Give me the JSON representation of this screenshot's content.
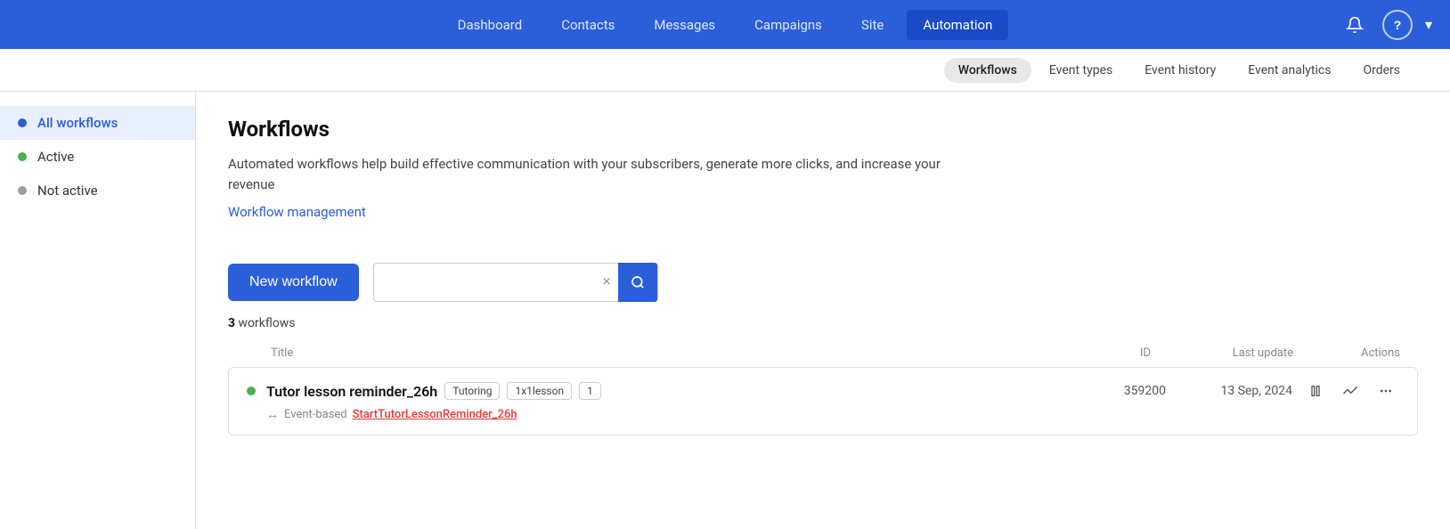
{
  "topnav": {
    "links": [
      {
        "label": "Dashboard",
        "active": false
      },
      {
        "label": "Contacts",
        "active": false
      },
      {
        "label": "Messages",
        "active": false
      },
      {
        "label": "Campaigns",
        "active": false
      },
      {
        "label": "Site",
        "active": false
      },
      {
        "label": "Automation",
        "active": true
      }
    ],
    "icons": {
      "bell": "🔔",
      "help": "?",
      "chevron": "▾"
    }
  },
  "subnav": {
    "items": [
      {
        "label": "Workflows",
        "active": true
      },
      {
        "label": "Event types",
        "active": false
      },
      {
        "label": "Event history",
        "active": false
      },
      {
        "label": "Event analytics",
        "active": false
      },
      {
        "label": "Orders",
        "active": false
      }
    ]
  },
  "sidebar": {
    "items": [
      {
        "label": "All workflows",
        "dot": "blue",
        "active": true
      },
      {
        "label": "Active",
        "dot": "green",
        "active": false
      },
      {
        "label": "Not active",
        "dot": "gray",
        "active": false
      }
    ]
  },
  "content": {
    "page_title": "Workflows",
    "description": "Automated workflows help build effective communication with your subscribers, generate more clicks, and increase your revenue",
    "management_link": "Workflow management",
    "new_workflow_btn": "New workflow",
    "search_clear": "×",
    "workflow_count_number": "3",
    "workflow_count_text": "workflows",
    "table_header": {
      "title": "Title",
      "id": "ID",
      "last_update": "Last update",
      "actions": "Actions"
    },
    "workflows": [
      {
        "title": "Tutor lesson reminder_26h",
        "tags": [
          "Tutoring",
          "1x1lesson",
          "1"
        ],
        "id": "359200",
        "last_update": "13 Sep, 2024",
        "status": "active",
        "event_type": "Event-based",
        "event_name": "StartTutorLessonReminder_26h"
      }
    ]
  }
}
